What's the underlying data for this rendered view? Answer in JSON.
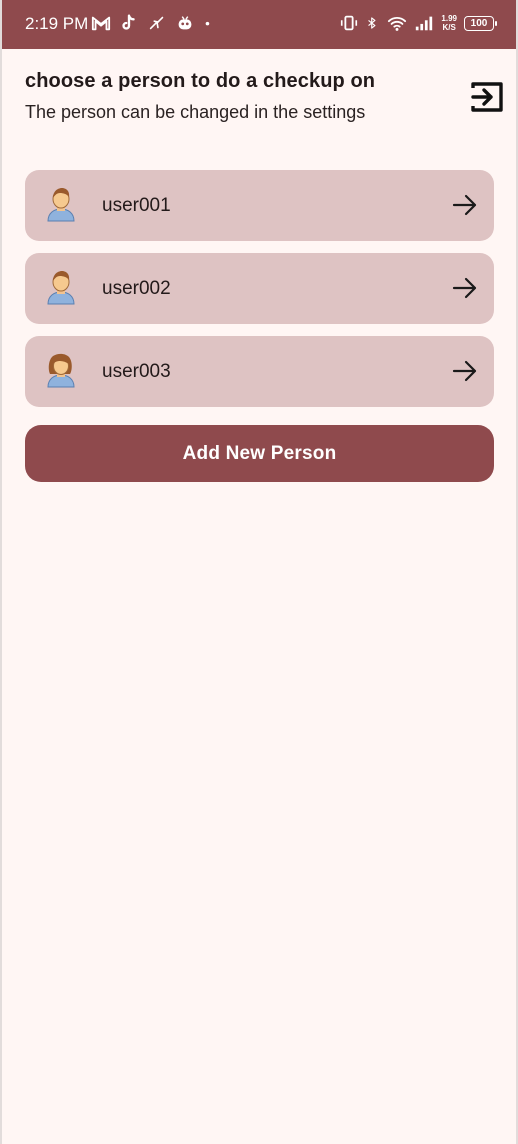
{
  "status_bar": {
    "time": "2:19 PM",
    "net_speed_value": "1.99",
    "net_speed_unit": "K/S",
    "battery": "100",
    "icons_left": [
      "gmail-icon",
      "tiktok-icon",
      "bird-icon",
      "bot-icon",
      "dot-icon"
    ],
    "icons_right": [
      "vibrate-icon",
      "bluetooth-icon",
      "wifi-icon",
      "signal-icon"
    ]
  },
  "header": {
    "title": "choose a person to do a checkup on",
    "subtitle": "The person can be changed in the settings",
    "logout_icon": "logout-icon"
  },
  "persons": [
    {
      "name": "user001",
      "avatar": "male-avatar-icon"
    },
    {
      "name": "user002",
      "avatar": "male-avatar-icon"
    },
    {
      "name": "user003",
      "avatar": "female-avatar-icon"
    }
  ],
  "add_button_label": "Add New Person",
  "colors": {
    "primary": "#8f4a4d",
    "card": "#dec3c3",
    "background": "#fff6f4"
  }
}
